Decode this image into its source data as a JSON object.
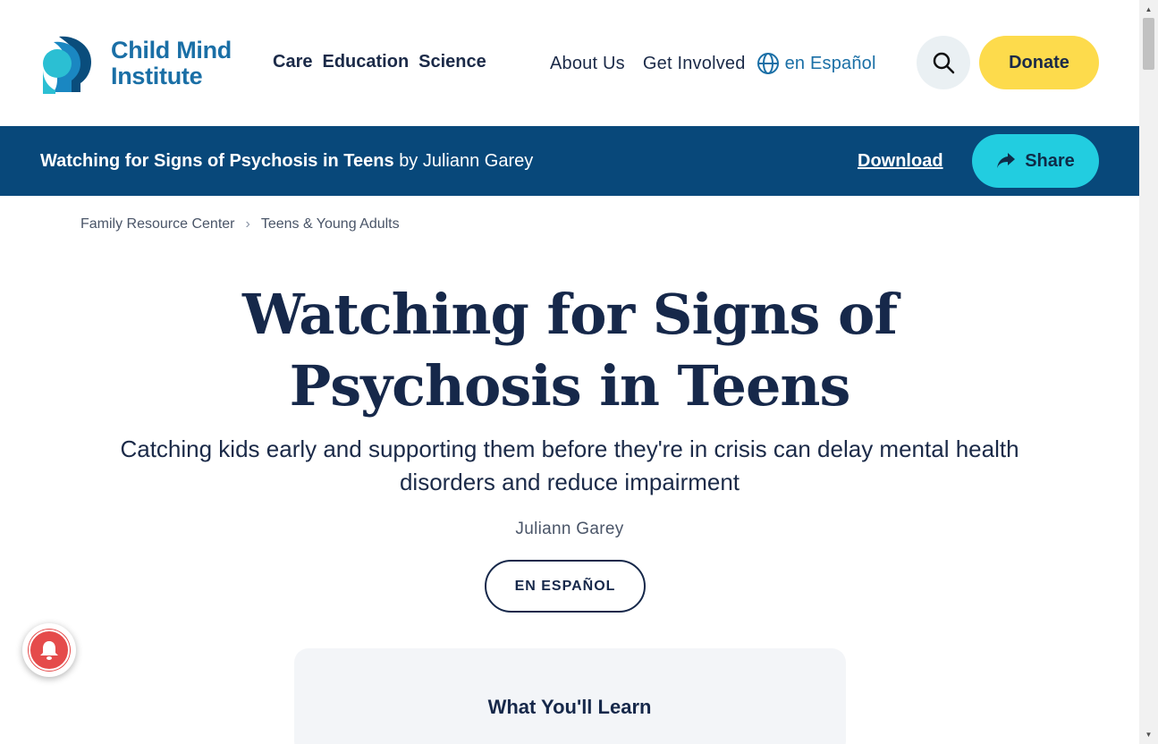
{
  "brand": {
    "name_line1": "Child Mind",
    "name_line2": "Institute",
    "color": "#1a6fa6"
  },
  "nav": {
    "primary": [
      "Care",
      "Education",
      "Science"
    ],
    "secondary": [
      "About Us",
      "Get Involved"
    ],
    "language": "en Español",
    "donate": "Donate",
    "search_icon": "search-icon",
    "donate_color": "#fddb4c"
  },
  "article_bar": {
    "title": "Watching for Signs of Psychosis in Teens",
    "by": "by Juliann Garey",
    "download": "Download",
    "share": "Share",
    "bar_color": "#08487a",
    "share_color": "#22cde0"
  },
  "breadcrumb": [
    "Family Resource Center",
    "Teens & Young Adults"
  ],
  "article": {
    "headline": "Watching for Signs of Psychosis in Teens",
    "subhead": "Catching kids early and supporting them before they're in crisis can delay mental health disorders and reduce impairment",
    "author": "Juliann Garey",
    "spanish_button": "EN ESPAÑOL",
    "learn_title": "What You'll Learn"
  }
}
